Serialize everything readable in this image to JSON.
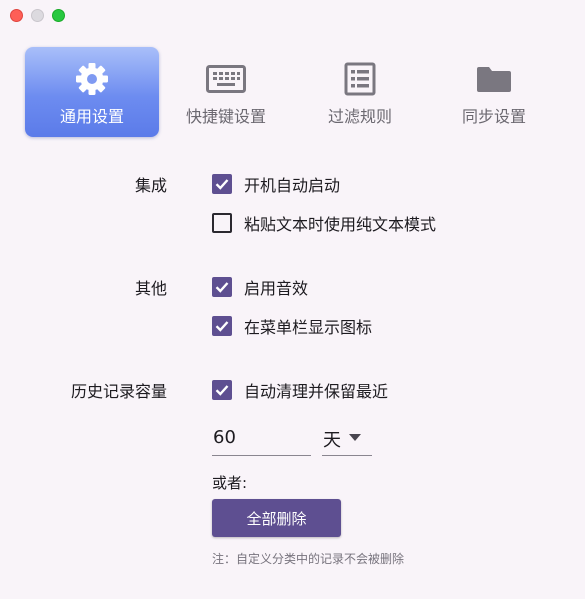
{
  "window": {
    "controls": [
      "close",
      "minimize",
      "zoom"
    ]
  },
  "tabs": [
    {
      "label": "通用设置",
      "icon": "gear-icon",
      "active": true
    },
    {
      "label": "快捷键设置",
      "icon": "keyboard-icon",
      "active": false
    },
    {
      "label": "过滤规则",
      "icon": "list-icon",
      "active": false
    },
    {
      "label": "同步设置",
      "icon": "folder-icon",
      "active": false
    }
  ],
  "sections": {
    "integration": {
      "label": "集成",
      "options": [
        {
          "label": "开机自动启动",
          "checked": true
        },
        {
          "label": "粘贴文本时使用纯文本模式",
          "checked": false
        }
      ]
    },
    "other": {
      "label": "其他",
      "options": [
        {
          "label": "启用音效",
          "checked": true
        },
        {
          "label": "在菜单栏显示图标",
          "checked": true
        }
      ]
    },
    "history": {
      "label": "历史记录容量",
      "options": [
        {
          "label": "自动清理并保留最近",
          "checked": true
        }
      ],
      "days_value": "60",
      "unit": "天",
      "or_label": "或者:",
      "delete_all_label": "全部删除",
      "note": "注：自定义分类中的记录不会被删除"
    }
  },
  "colors": {
    "accent": "#5e4f91",
    "tab_active_top": "#a9bff9",
    "tab_active_bottom": "#5b7be9",
    "background": "#f9f4f9"
  }
}
